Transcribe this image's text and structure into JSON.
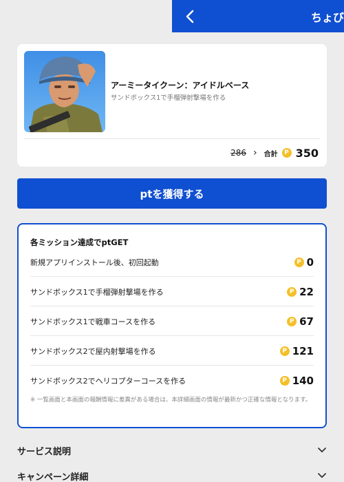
{
  "header": {
    "title": "ちょび"
  },
  "app": {
    "name": "アーミータイクーン：アイドルベース",
    "description": "サンドボックス1で手榴弾射撃場を作る",
    "old_price": "286",
    "arrow": "›",
    "total_label": "合計",
    "total_value": "350"
  },
  "coin_symbol": "P",
  "cta": {
    "label": "ptを獲得する"
  },
  "missions": {
    "header": "各ミッション達成でptGET",
    "items": [
      {
        "label": "新規アプリインストール後、初回起動",
        "points": "0"
      },
      {
        "label": "サンドボックス1で手榴弾射撃場を作る",
        "points": "22"
      },
      {
        "label": "サンドボックス1で戦車コースを作る",
        "points": "67"
      },
      {
        "label": "サンドボックス2で屋内射撃場を作る",
        "points": "121"
      },
      {
        "label": "サンドボックス2でヘリコプターコースを作る",
        "points": "140"
      }
    ],
    "note": "※ 一覧画面と本画面の報酬情報に差異がある場合は、本詳細画面の情報が最新かつ正確な情報となります。"
  },
  "sections": [
    {
      "label": "サービス説明"
    },
    {
      "label": "キャンペーン詳細"
    }
  ],
  "colors": {
    "brand": "#0f4fd1",
    "coin": "#f4bf28"
  }
}
